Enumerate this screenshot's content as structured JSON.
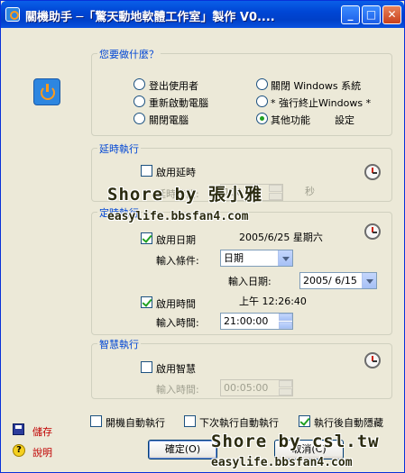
{
  "window": {
    "title": "關機助手 ─「驚天動地軟體工作室」製作 V0....",
    "minimize": "_",
    "maximize": "□",
    "close": "✕"
  },
  "action_group": {
    "label": "您要做什麼？",
    "options": [
      {
        "label": "登出使用者",
        "selected": false
      },
      {
        "label": "重新啟動電腦",
        "selected": false
      },
      {
        "label": "關閉電腦",
        "selected": false
      },
      {
        "label": "關閉 Windows 系統",
        "selected": false
      },
      {
        "label": "* 強行終止Windows *",
        "selected": false
      },
      {
        "label": "其他功能",
        "selected": true
      }
    ],
    "settings_label": "設定"
  },
  "delay_group": {
    "label": "延時執行",
    "enable_label": "啟用延時",
    "enabled": false,
    "time_label": "延時時間:",
    "time_value": "100",
    "unit": "秒"
  },
  "timer_group": {
    "label": "定時執行",
    "date_enable_label": "啟用日期",
    "date_enabled": true,
    "date_display": "2005/6/25 星期六",
    "condition_label": "輸入條件:",
    "condition_value": "日期",
    "date_input_label": "輸入日期:",
    "date_input_value": "2005/ 6/15",
    "time_enable_label": "啟用時間",
    "time_enabled": true,
    "time_display": "上午 12:26:40",
    "time_input_label": "輸入時間:",
    "time_input_value": "21:00:00"
  },
  "smart_group": {
    "label": "智慧執行",
    "enable_label": "啟用智慧",
    "enabled": false,
    "time_input_label": "輸入時間:",
    "time_input_value": "00:05:00"
  },
  "options": [
    {
      "label": "開機自動執行",
      "checked": false
    },
    {
      "label": "下次執行自動執行",
      "checked": false
    },
    {
      "label": "執行後自動隱藏",
      "checked": true
    }
  ],
  "side": {
    "save_label": "儲存",
    "help_label": "說明"
  },
  "buttons": {
    "ok_label": "確定(O)",
    "cancel_label": "取消(C)"
  },
  "watermarks": {
    "w1_main": "Shore by",
    "w1_name": "張小雅",
    "w1_url": "easylife.bbsfan4.com",
    "w2_main": "Shore by csl.tw",
    "w2_url": "easylife.bbsfan4.com"
  }
}
